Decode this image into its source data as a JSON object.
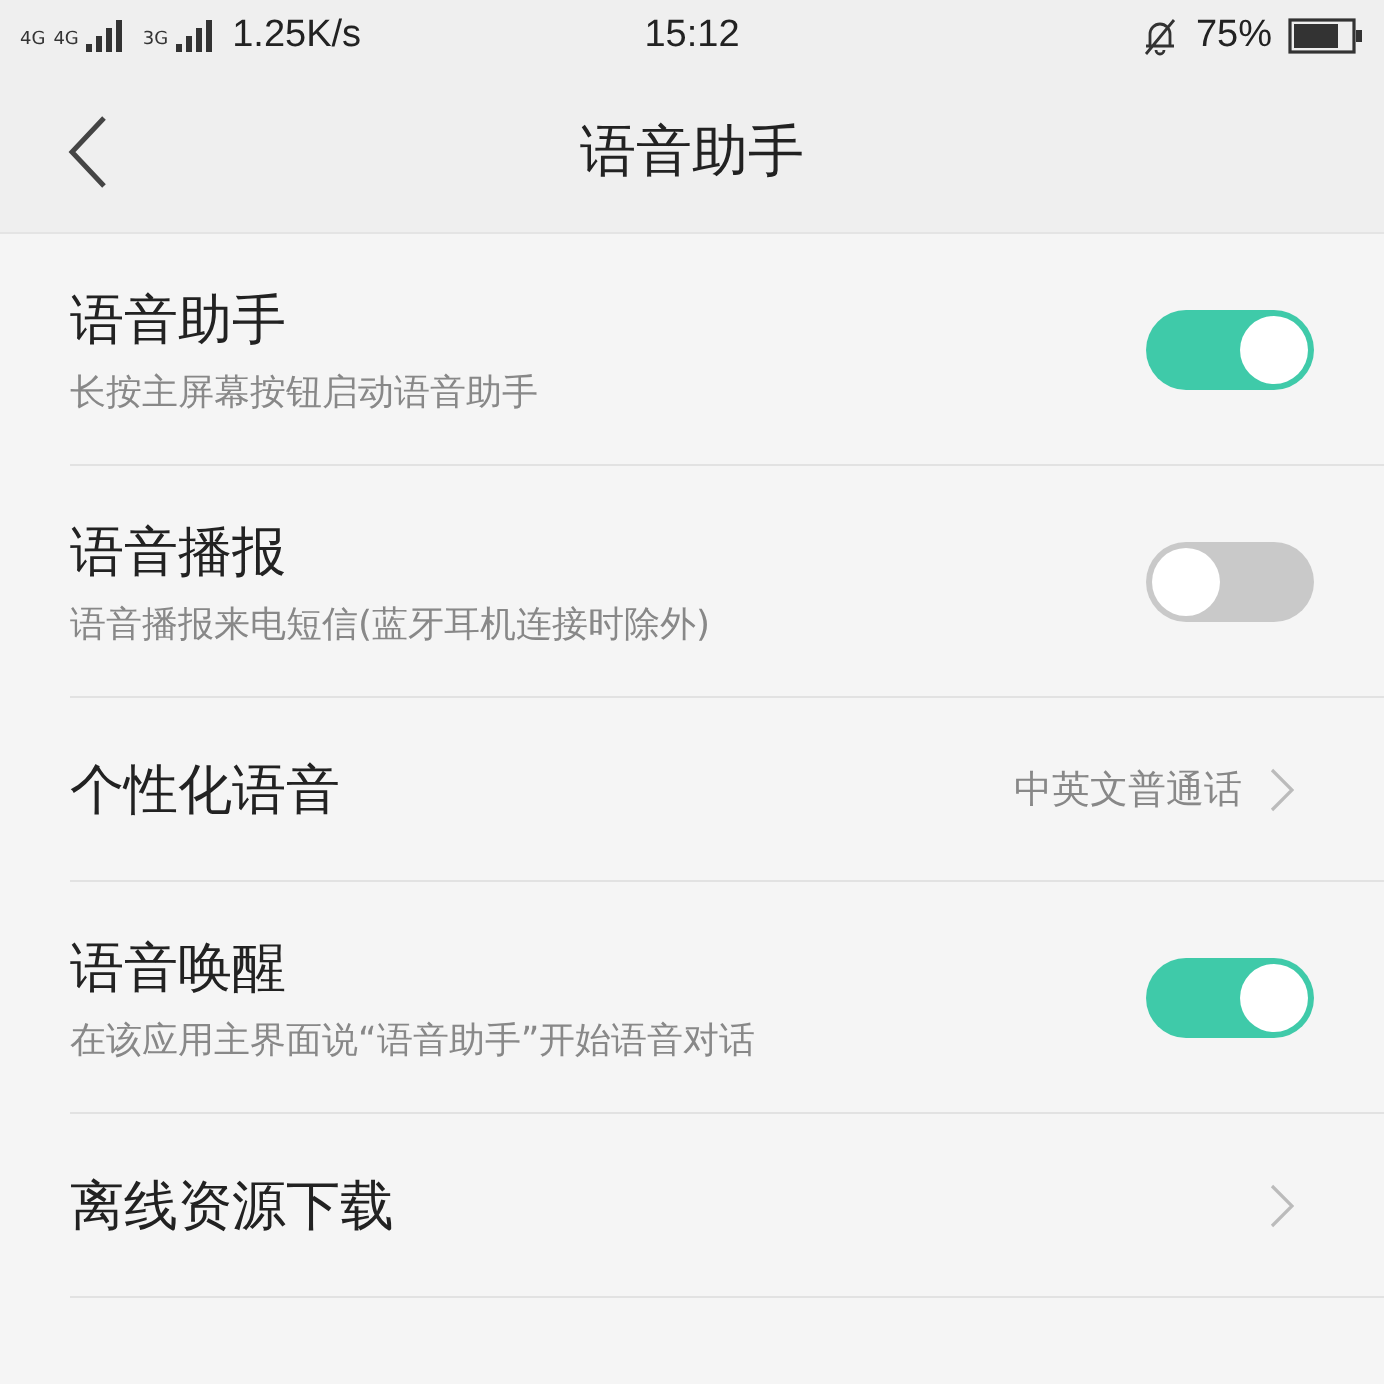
{
  "status_bar": {
    "network_labels": [
      "4G",
      "4G",
      "3G"
    ],
    "speed": "1.25K/s",
    "time": "15:12",
    "battery": "75%"
  },
  "header": {
    "title": "语音助手"
  },
  "settings": [
    {
      "kind": "toggle",
      "title": "语音助手",
      "subtitle": "长按主屏幕按钮启动语音助手",
      "on": true
    },
    {
      "kind": "toggle",
      "title": "语音播报",
      "subtitle": "语音播报来电短信(蓝牙耳机连接时除外)",
      "on": false
    },
    {
      "kind": "link",
      "title": "个性化语音",
      "value": "中英文普通话"
    },
    {
      "kind": "toggle",
      "title": "语音唤醒",
      "subtitle": "在该应用主界面说“语音助手”开始语音对话",
      "on": true
    },
    {
      "kind": "link",
      "title": "离线资源下载"
    }
  ]
}
